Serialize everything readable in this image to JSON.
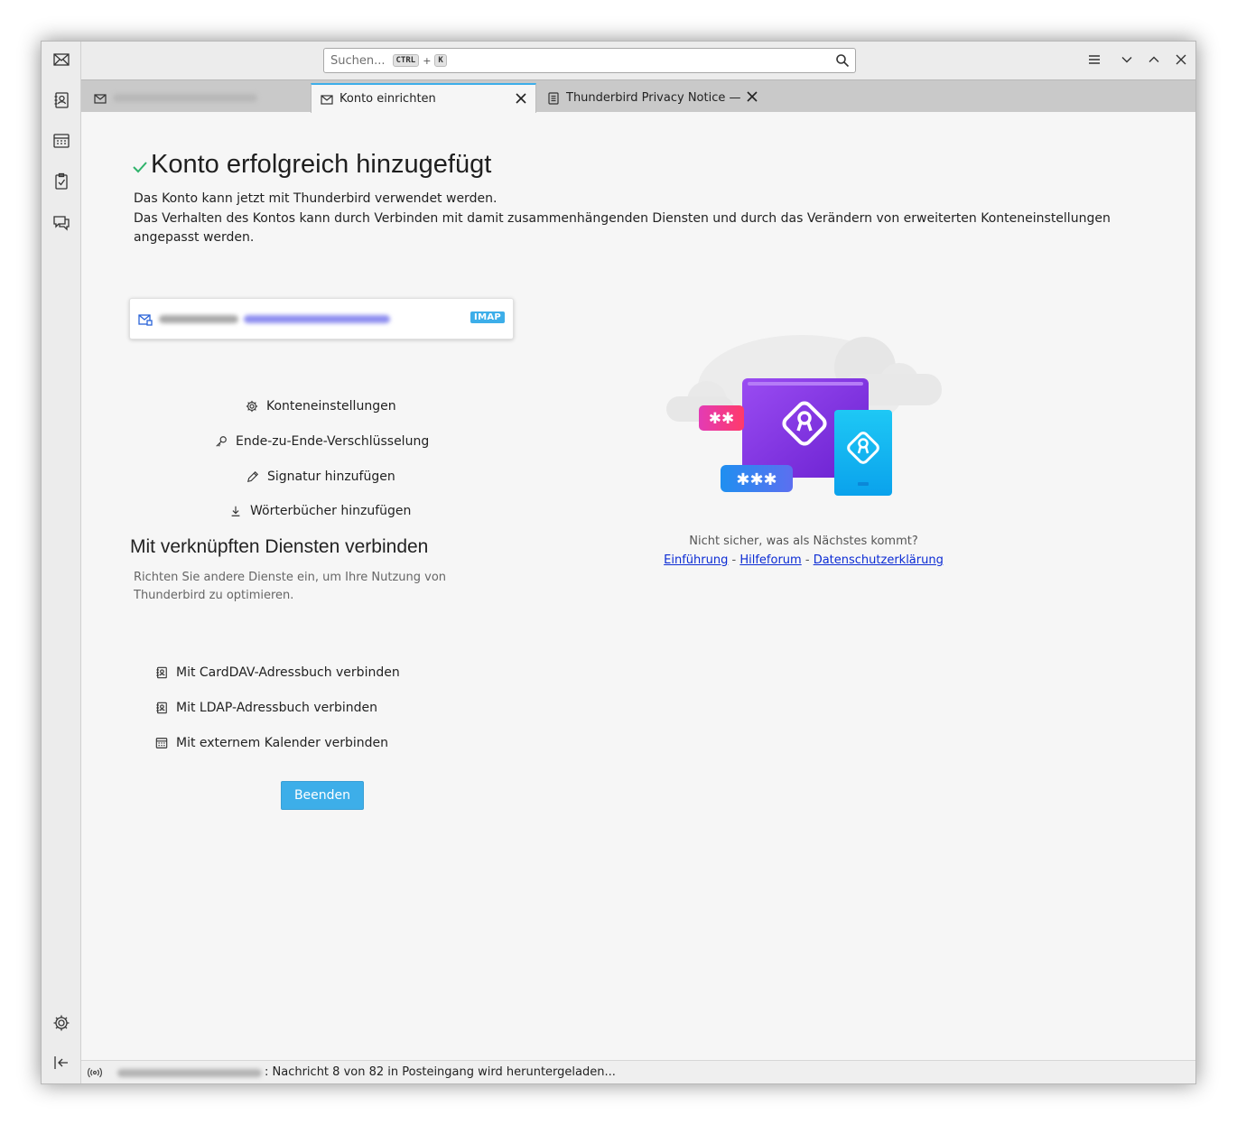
{
  "search": {
    "placeholder": "Suchen...",
    "shortcut_key1": "CTRL",
    "shortcut_plus": "+",
    "shortcut_key2": "K"
  },
  "tabs": [
    {
      "label": "",
      "icon": "mail-icon",
      "active": false
    },
    {
      "label": "Konto einrichten",
      "icon": "mail-icon",
      "active": true
    },
    {
      "label": "Thunderbird Privacy Notice —",
      "icon": "document-icon",
      "active": false
    }
  ],
  "spaces": [
    "mail-icon",
    "address-book-icon",
    "calendar-icon",
    "tasks-icon",
    "chat-icon",
    "settings-icon",
    "collapse-icon"
  ],
  "main": {
    "title": "Konto erfolgreich hinzugefügt",
    "intro_line1": "Das Konto kann jetzt mit Thunderbird verwendet werden.",
    "intro_line2": "Das Verhalten des Kontos kann durch Verbinden mit damit zusammenhängenden Diensten und durch das Verändern von erweiterten Konteneinstellungen angepasst werden.",
    "account": {
      "badge": "IMAP"
    },
    "actions": [
      {
        "label": "Konteneinstellungen",
        "icon": "gear-icon"
      },
      {
        "label": "Ende-zu-Ende-Verschlüsselung",
        "icon": "key-icon"
      },
      {
        "label": "Signatur hinzufügen",
        "icon": "pencil-icon"
      },
      {
        "label": "Wörterbücher hinzufügen",
        "icon": "download-icon"
      }
    ],
    "services_title": "Mit verknüpften Diensten verbinden",
    "services_desc": "Richten Sie andere Dienste ein, um Ihre Nutzung von Thunderbird zu optimieren.",
    "services": [
      {
        "label": "Mit CardDAV-Adressbuch verbinden",
        "icon": "address-book-icon"
      },
      {
        "label": "Mit LDAP-Adressbuch verbinden",
        "icon": "address-book-icon"
      },
      {
        "label": "Mit externem Kalender verbinden",
        "icon": "calendar-icon"
      }
    ],
    "finish_label": "Beenden",
    "help_text": "Nicht sicher, was als Nächstes kommt?",
    "help_links": [
      "Einführung",
      "Hilfeforum",
      "Datenschutzerklärung"
    ],
    "help_sep": "-"
  },
  "status": {
    "text": ": Nachricht 8 von 82 in Posteingang wird heruntergeladen..."
  },
  "colors": {
    "accent": "#3daee9",
    "success": "#2fb36b",
    "link": "#0b2bd4"
  }
}
